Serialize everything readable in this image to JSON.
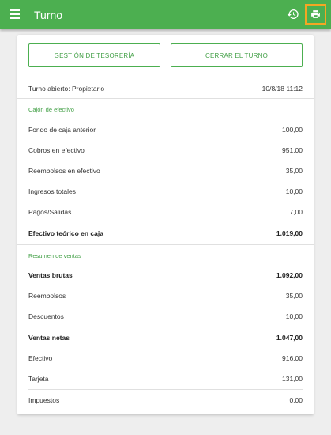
{
  "appbar": {
    "title": "Turno"
  },
  "actions": {
    "treasury_label": "GESTIÓN DE TESORERÍA",
    "close_shift_label": "CERRAR EL TURNO"
  },
  "shift": {
    "label": "Turno abierto: Propietario",
    "datetime": "10/8/18 11:12"
  },
  "cash": {
    "title": "Cajón de efectivo",
    "rows": [
      {
        "label": "Fondo de caja anterior",
        "value": "100,00"
      },
      {
        "label": "Cobros en efectivo",
        "value": "951,00"
      },
      {
        "label": "Reembolsos en efectivo",
        "value": "35,00"
      },
      {
        "label": "Ingresos totales",
        "value": "10,00"
      },
      {
        "label": "Pagos/Salidas",
        "value": "7,00"
      },
      {
        "label": "Efectivo teórico en caja",
        "value": "1.019,00"
      }
    ]
  },
  "sales": {
    "title": "Resumen de ventas",
    "rows": [
      {
        "label": "Ventas brutas",
        "value": "1.092,00"
      },
      {
        "label": "Reembolsos",
        "value": "35,00"
      },
      {
        "label": "Descuentos",
        "value": "10,00"
      },
      {
        "label": "Ventas netas",
        "value": "1.047,00"
      },
      {
        "label": "Efectivo",
        "value": "916,00"
      },
      {
        "label": "Tarjeta",
        "value": "131,00"
      },
      {
        "label": "Impuestos",
        "value": "0,00"
      }
    ]
  },
  "colors": {
    "primary": "#4caf50",
    "accent_text": "#43a047",
    "highlight": "#f5a623"
  },
  "icons": {
    "menu": "menu-icon",
    "history": "history-icon",
    "print": "print-icon"
  }
}
